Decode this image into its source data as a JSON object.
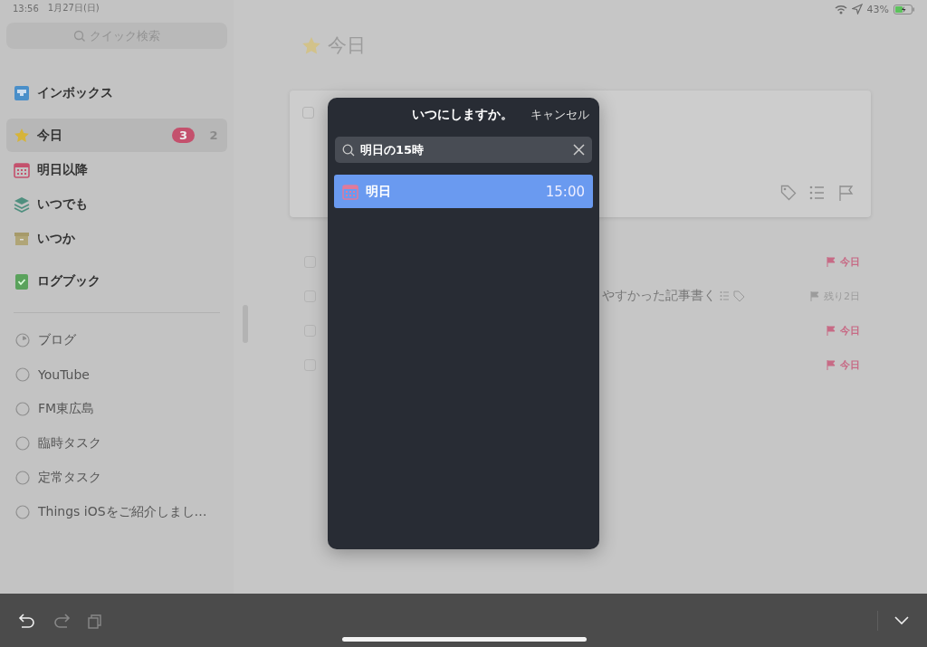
{
  "status_bar": {
    "time": "13:56",
    "date": "1月27日(日)",
    "battery": "43%"
  },
  "sidebar": {
    "search": {
      "placeholder": "クイック検索"
    },
    "lists": [
      {
        "kind": "inbox",
        "label": "インボックス",
        "selected": false
      },
      {
        "kind": "today",
        "label": "今日",
        "selected": true,
        "badge": "3",
        "count": "2"
      },
      {
        "kind": "upcoming",
        "label": "明日以降",
        "selected": false
      },
      {
        "kind": "anytime",
        "label": "いつでも",
        "selected": false
      },
      {
        "kind": "someday",
        "label": "いつか",
        "selected": false
      },
      {
        "kind": "logbook",
        "label": "ログブック",
        "selected": false
      }
    ],
    "projects": [
      {
        "kind": "started",
        "name": "ブログ"
      },
      {
        "kind": "empty",
        "name": "YouTube"
      },
      {
        "kind": "empty",
        "name": "FM東広島"
      },
      {
        "kind": "empty",
        "name": "臨時タスク"
      },
      {
        "kind": "empty",
        "name": "定常タスク"
      },
      {
        "kind": "empty",
        "name": "Things iOSをご紹介しまし…"
      }
    ]
  },
  "main": {
    "title": "今日",
    "card": {
      "checked": false
    },
    "tasks": [
      {
        "checked": false,
        "due_today": true,
        "deadline": "今日"
      },
      {
        "checked": false,
        "text": "やすかった記事書く",
        "has_checklist": true,
        "has_tags": true,
        "due_today": false,
        "deadline": "残り2日"
      },
      {
        "checked": false,
        "due_today": true,
        "deadline": "今日"
      },
      {
        "checked": false,
        "due_today": true,
        "deadline": "今日"
      }
    ]
  },
  "popup": {
    "title": "いつにしますか。",
    "cancel": "キャンセル",
    "search_value": "明日の15時",
    "results": [
      {
        "label": "明日",
        "time": "15:00",
        "selected": true
      }
    ]
  },
  "toolbar": [
    {
      "kind": "undo",
      "disabled": false
    },
    {
      "kind": "redo",
      "disabled": true
    },
    {
      "kind": "duplicate",
      "disabled": true
    }
  ]
}
